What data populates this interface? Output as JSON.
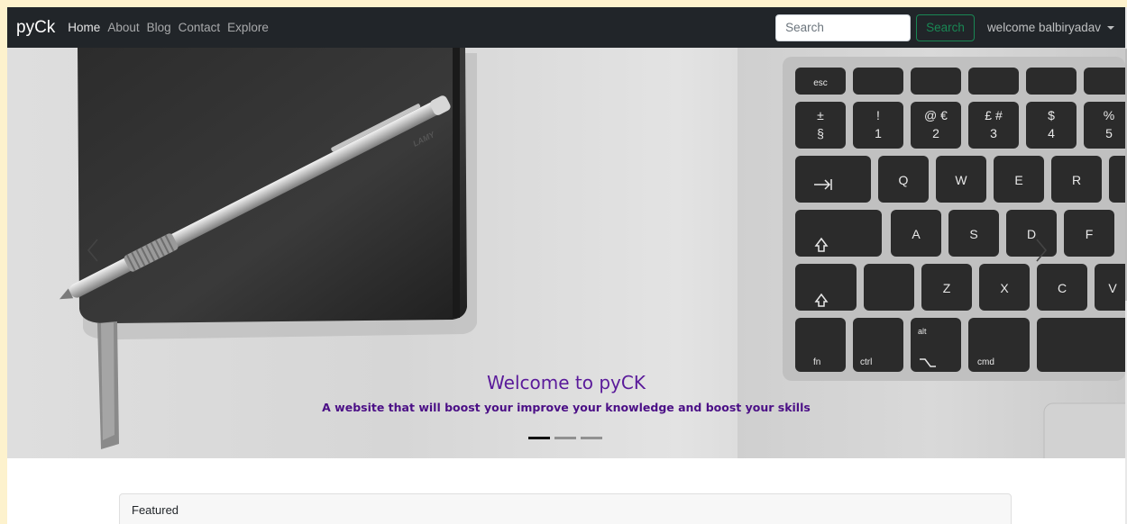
{
  "navbar": {
    "brand": "pyCk",
    "links": [
      {
        "label": "Home"
      },
      {
        "label": "About"
      },
      {
        "label": "Blog"
      },
      {
        "label": "Contact"
      },
      {
        "label": "Explore"
      }
    ],
    "search": {
      "placeholder": "Search",
      "value": ""
    },
    "search_button": "Search",
    "user": "welcome balbiryadav"
  },
  "carousel": {
    "slide": {
      "title": "Welcome to pyCK",
      "subtitle": "A website that will boost your improve your knowledge and boost your skills"
    },
    "indicator_count": 3,
    "active_index": 0,
    "laptop_keys": {
      "row_fn": [
        "esc"
      ],
      "row_num": [
        [
          "±",
          "§"
        ],
        [
          "!",
          "1"
        ],
        [
          "@ €",
          "2"
        ],
        [
          "£ #",
          "3"
        ],
        [
          "$",
          "4"
        ],
        [
          "%",
          "5"
        ]
      ],
      "row_q": [
        "Q",
        "W",
        "E",
        "R"
      ],
      "row_a": [
        "A",
        "S",
        "D",
        "F"
      ],
      "row_z": [
        "Z",
        "X",
        "C",
        "V"
      ],
      "row_bottom": [
        "fn",
        "ctrl",
        "alt",
        "cmd"
      ],
      "pen_brand": "LAMY"
    }
  },
  "featured": {
    "header": "Featured"
  },
  "colors": {
    "navbar_bg": "#212529",
    "success": "#198754",
    "caption_title": "#5a1a9a",
    "caption_sub": "#4b0f86",
    "page_bg": "#fdf2cd"
  }
}
